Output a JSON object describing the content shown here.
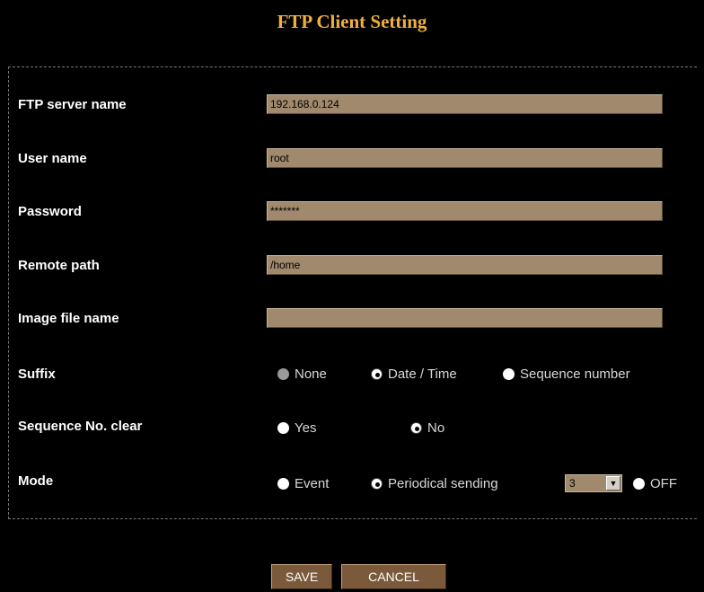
{
  "title": "FTP Client Setting",
  "fields": {
    "server": {
      "label": "FTP server name",
      "value": "192.168.0.124"
    },
    "user": {
      "label": "User name",
      "value": "root"
    },
    "password": {
      "label": "Password",
      "value": "*******"
    },
    "path": {
      "label": "Remote path",
      "value": "/home"
    },
    "image": {
      "label": "Image file name",
      "value": ""
    }
  },
  "suffix": {
    "label": "Suffix",
    "options": [
      "None",
      "Date / Time",
      "Sequence number"
    ],
    "selected": "Date / Time"
  },
  "seqclear": {
    "label": "Sequence No. clear",
    "options": [
      "Yes",
      "No"
    ],
    "selected": "No"
  },
  "mode": {
    "label": "Mode",
    "options": [
      "Event",
      "Periodical sending",
      "OFF"
    ],
    "selected": "Periodical sending",
    "interval": "3"
  },
  "buttons": {
    "save": "SAVE",
    "cancel": "CANCEL"
  },
  "colors": {
    "title": "#f0b040",
    "field_bg": "#a0896c",
    "button_bg": "#7a5a3a"
  }
}
